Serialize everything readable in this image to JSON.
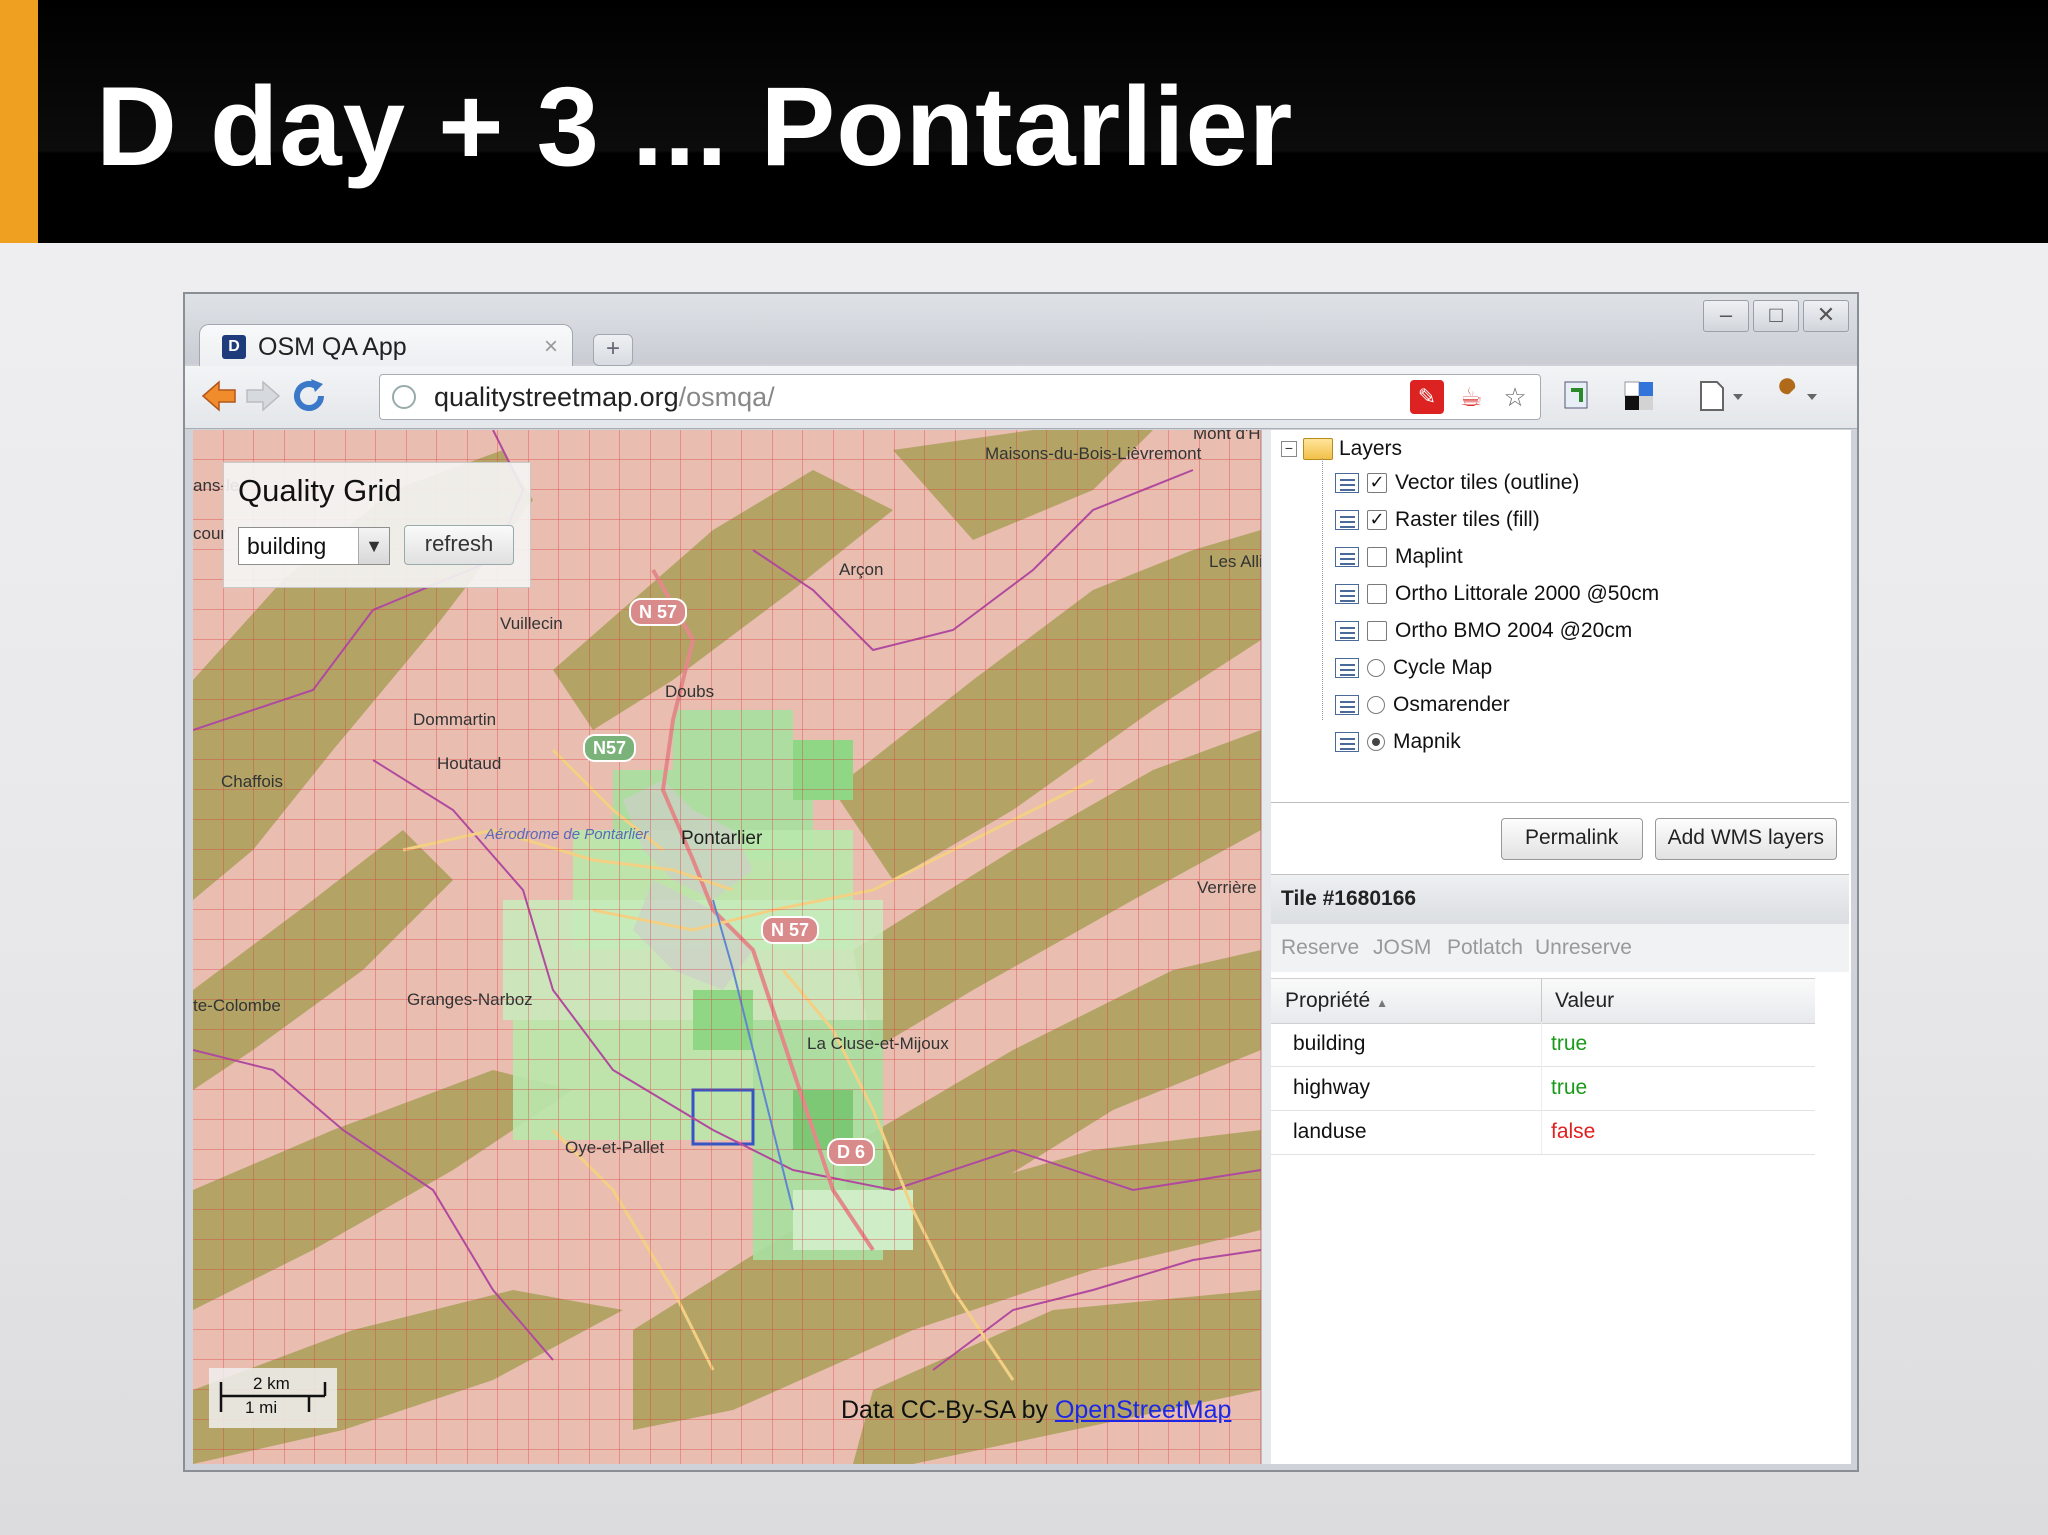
{
  "slide": {
    "title": "D day + 3 ... Pontarlier"
  },
  "browser": {
    "tab_title": "OSM QA App",
    "tab_favicon": "D",
    "tab_close": "×",
    "new_tab": "+",
    "url_host": "qualitystreetmap.org",
    "url_path": "/osmqa/",
    "window_controls": [
      "–",
      "□",
      "✕"
    ],
    "icons": [
      "back-arrow-icon",
      "forward-arrow-icon",
      "reload-icon",
      "globe-icon",
      "adobe-icon",
      "addon-icon",
      "star-icon",
      "extension-icon",
      "delicious-icon",
      "page-menu-icon",
      "wrench-icon"
    ]
  },
  "quality_grid": {
    "title": "Quality Grid",
    "select_value": "building",
    "refresh_label": "refresh"
  },
  "map": {
    "labels": [
      "Maisons-du-Bois-Lièvremont",
      "Arçon",
      "Les Alli",
      "Vuillecin",
      "Doubs",
      "Dommartin",
      "Houtaud",
      "Chaffois",
      "Aérodrome de Pontarlier",
      "Pontarlier",
      "Verrière",
      "Granges-Narboz",
      "te-Colombe",
      "La Cluse-et-Mijoux",
      "Oye-et-Pallet",
      "ans-le",
      "cour",
      "Mont d'H"
    ],
    "shields": [
      "N 57",
      "N57",
      "N 57",
      "D 6"
    ],
    "scale_km": "2 km",
    "scale_mi": "1 mi",
    "attribution_prefix": "Data CC-By-SA by ",
    "attribution_link": "OpenStreetMap"
  },
  "layers": {
    "root": "Layers",
    "items": [
      {
        "label": "Vector tiles (outline)",
        "control": "checkbox",
        "checked": true
      },
      {
        "label": "Raster tiles (fill)",
        "control": "checkbox",
        "checked": true
      },
      {
        "label": "Maplint",
        "control": "checkbox",
        "checked": false
      },
      {
        "label": "Ortho Littorale 2000 @50cm",
        "control": "checkbox",
        "checked": false
      },
      {
        "label": "Ortho BMO 2004 @20cm",
        "control": "checkbox",
        "checked": false
      },
      {
        "label": "Cycle Map",
        "control": "radio",
        "checked": false
      },
      {
        "label": "Osmarender",
        "control": "radio",
        "checked": false
      },
      {
        "label": "Mapnik",
        "control": "radio",
        "checked": true
      }
    ]
  },
  "buttons": {
    "permalink": "Permalink",
    "add_wms": "Add WMS layers"
  },
  "tile": {
    "title": "Tile #1680166",
    "actions": [
      "Reserve",
      "JOSM",
      "Potlatch",
      "Unreserve"
    ]
  },
  "properties": {
    "col_property": "Propriété",
    "sort_indicator": "▲",
    "col_value": "Valeur",
    "rows": [
      {
        "property": "building",
        "value": "true",
        "color": "#1a9a1a"
      },
      {
        "property": "highway",
        "value": "true",
        "color": "#1a9a1a"
      },
      {
        "property": "landuse",
        "value": "false",
        "color": "#e02020"
      }
    ]
  },
  "colors": {
    "accent": "#f0a020",
    "link": "#1e27e6",
    "true": "#1a9a1a",
    "false": "#e02020"
  }
}
